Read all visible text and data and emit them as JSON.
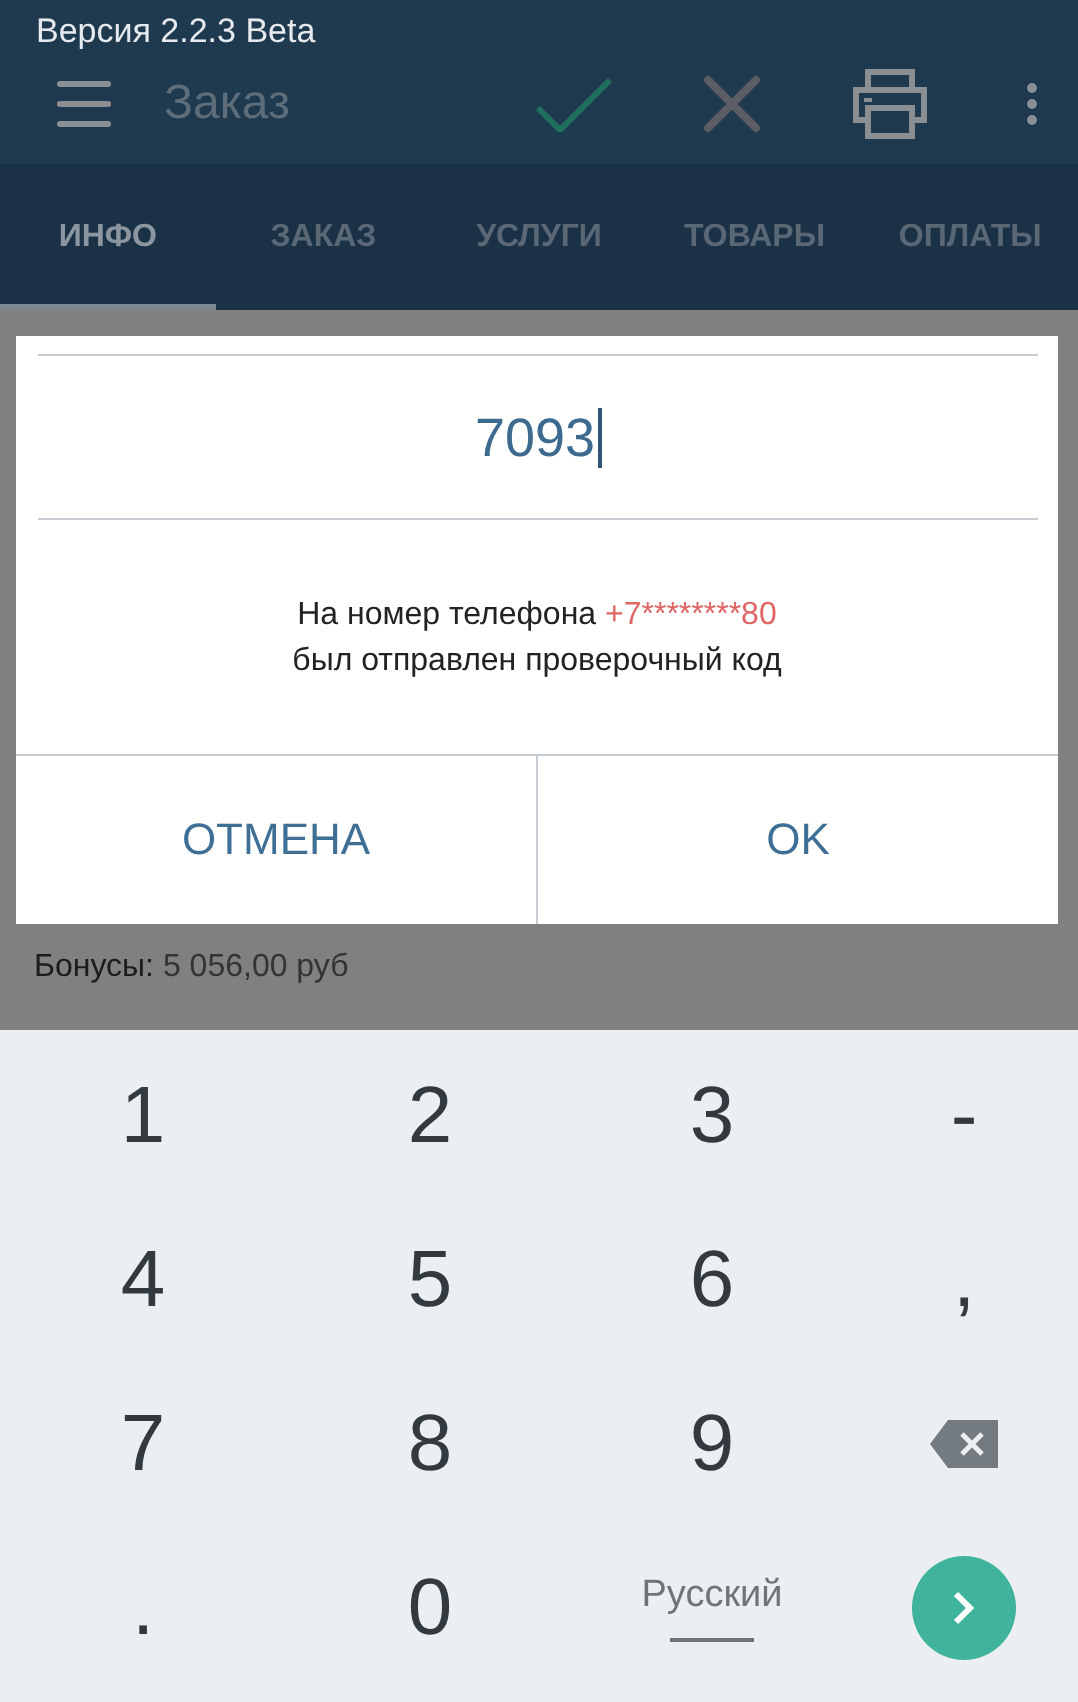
{
  "status_bar": {
    "text": "Версия 2.2.3 Beta"
  },
  "toolbar": {
    "title": "Заказ"
  },
  "tabs": [
    {
      "label": "ИНФО",
      "selected": true
    },
    {
      "label": "ЗАКАЗ",
      "selected": false
    },
    {
      "label": "УСЛУГИ",
      "selected": false
    },
    {
      "label": "ТОВАРЫ",
      "selected": false
    },
    {
      "label": "ОПЛАТЫ",
      "selected": false
    }
  ],
  "content": {
    "bonus_label": "Бонусы:",
    "bonus_value": "5 056,00 руб"
  },
  "dialog": {
    "code_value": "7093",
    "message_start": "На номер телефона",
    "phone": "+7********80",
    "message_end": "был отправлен проверочный код",
    "buttons": [
      "ОТМЕНА",
      "OK"
    ]
  },
  "keyboard": {
    "keys": [
      {
        "kind": "char",
        "label": "1"
      },
      {
        "kind": "char",
        "label": "2"
      },
      {
        "kind": "char",
        "label": "3"
      },
      {
        "kind": "char",
        "label": "-"
      },
      {
        "kind": "char",
        "label": "4"
      },
      {
        "kind": "char",
        "label": "5"
      },
      {
        "kind": "char",
        "label": "6"
      },
      {
        "kind": "char",
        "label": ","
      },
      {
        "kind": "char",
        "label": "7"
      },
      {
        "kind": "char",
        "label": "8"
      },
      {
        "kind": "char",
        "label": "9"
      },
      {
        "kind": "backspace"
      },
      {
        "kind": "char",
        "label": "."
      },
      {
        "kind": "char",
        "label": "0"
      },
      {
        "kind": "language",
        "label": "Русский"
      },
      {
        "kind": "go"
      }
    ]
  }
}
